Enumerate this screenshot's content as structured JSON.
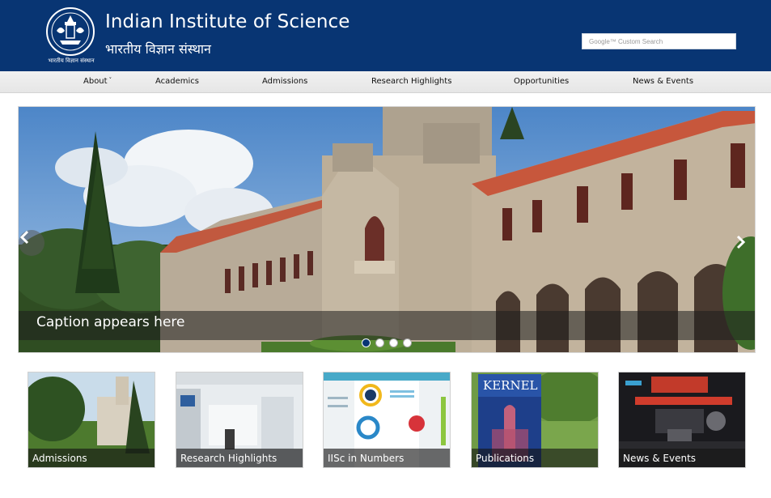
{
  "header": {
    "title_en": "Indian Institute of Science",
    "title_hi": "भारतीय विज्ञान संस्थान",
    "logo_caption": "भारतीय विज्ञान संस्थान",
    "search": {
      "placeholder": "Google™ Custom Search"
    },
    "bg_color": "#083573"
  },
  "nav": {
    "items": [
      {
        "label": "About",
        "has_dropdown": true
      },
      {
        "label": "Academics"
      },
      {
        "label": "Admissions"
      },
      {
        "label": "Research Highlights"
      },
      {
        "label": "Opportunities"
      },
      {
        "label": "News & Events"
      }
    ]
  },
  "slider": {
    "caption": "Caption appears here",
    "slide_count": 4,
    "active_slide": 1,
    "prev_icon": "chevron-left-icon",
    "next_icon": "chevron-right-icon"
  },
  "tiles": [
    {
      "label": "Admissions"
    },
    {
      "label": "Research Highlights"
    },
    {
      "label": "IISc in Numbers"
    },
    {
      "label": "Publications",
      "cover_title": "KERNEL"
    },
    {
      "label": "News & Events"
    }
  ]
}
